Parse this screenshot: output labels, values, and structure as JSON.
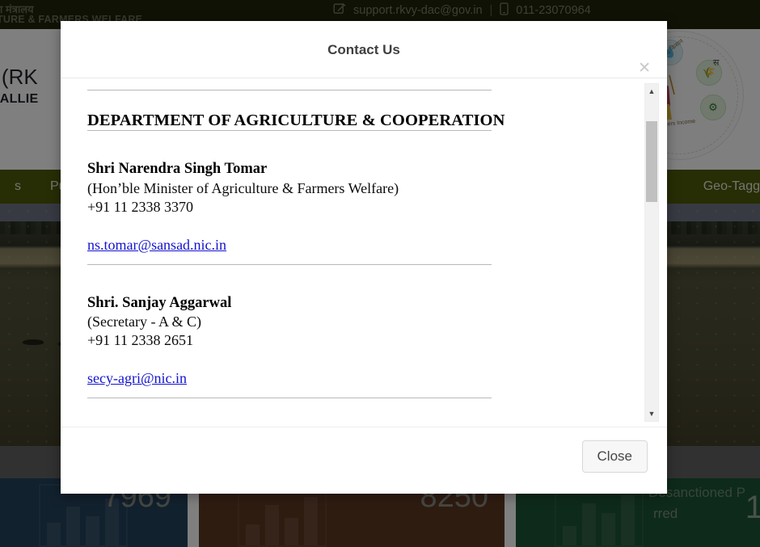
{
  "background": {
    "topbar": {
      "ministry_hindi": "ग मंत्रालय",
      "ministry_english": "TURE & FARMERS WELFARE",
      "mail_icon": "mail-edit-icon",
      "email": "support.rkvy-dac@gov.in",
      "separator": "|",
      "phone_icon": "mobile-phone-icon",
      "phone": "011-23070964"
    },
    "brand": {
      "title": "NA (RK",
      "subtitle": "AND ALLIE",
      "emblem_name": "doubling-farmers-income-emblem",
      "emblem_caption": "mers Income",
      "emblem_hindi": "ब्रम कृषी आय, समृद्ध किसान",
      "emblem_badge_1": "💧",
      "emblem_badge_2": "🌾",
      "emblem_badge_3": "⚙",
      "side_emblem_text": "स"
    },
    "nav": {
      "items": [
        {
          "label": "s",
          "caret": false
        },
        {
          "label": "Publi",
          "caret": false
        },
        {
          "label": "Geo-Tagg",
          "caret": false
        }
      ],
      "caret_glyph": "▼"
    },
    "cards": [
      {
        "name": "stat-card-1",
        "value": "7969",
        "label": "",
        "sub": ""
      },
      {
        "name": "stat-card-2",
        "value": "8250",
        "label": "",
        "sub": ""
      },
      {
        "name": "stat-card-3",
        "value": "1",
        "label": "Desanctioned P",
        "sub": "rred"
      }
    ]
  },
  "modal": {
    "title": "Contact Us",
    "close_icon": "close-icon",
    "close_glyph": "✕",
    "department_heading": "DEPARTMENT OF AGRICULTURE & COOPERATION",
    "contacts": [
      {
        "name": "Shri Narendra Singh Tomar",
        "role": "(Hon’ble Minister of Agriculture & Farmers Welfare)",
        "phone": "+91 11 2338 3370",
        "email": "ns.tomar@sansad.nic.in"
      },
      {
        "name": "Shri. Sanjay Aggarwal",
        "role": "(Secretary - A & C)",
        "phone": "+91 11 2338 2651",
        "email": "secy-agri@nic.in"
      }
    ],
    "scrollbar": {
      "up_glyph": "▲",
      "down_glyph": "▼"
    },
    "footer": {
      "close_label": "Close"
    }
  },
  "colors": {
    "topbar_bg": "#1f2408",
    "nav_bg": "#4e5a09",
    "card1_bg": "#24435c",
    "card2_bg": "#5e3823",
    "card3_bg": "#1c5434",
    "link": "#1212cf",
    "overlay": "rgba(0,0,0,0.5)"
  }
}
